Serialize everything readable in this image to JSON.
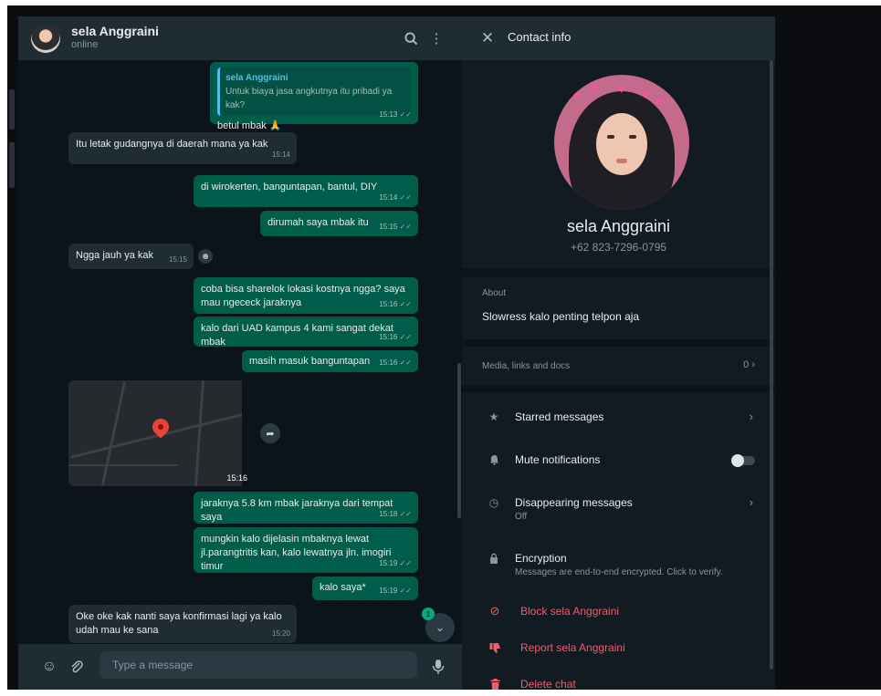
{
  "chat": {
    "contact_name": "sela Anggraini",
    "status": "online",
    "quoted": {
      "name": "sela Anggraini",
      "text": "Untuk biaya jasa angkutnya itu pribadi ya kak?"
    },
    "messages": [
      {
        "text": "betul mbak 🙏",
        "time": "15:13"
      },
      {
        "text": "Itu letak gudangnya di daerah mana ya kak",
        "time": "15:14"
      },
      {
        "text": "di wirokerten, banguntapan, bantul, DIY",
        "time": "15:14"
      },
      {
        "text": "dirumah saya mbak itu",
        "time": "15:15"
      },
      {
        "text": "Ngga jauh ya kak",
        "time": "15:15"
      },
      {
        "text": "coba bisa sharelok lokasi kostnya ngga? saya mau ngececk jaraknya",
        "time": "15:16"
      },
      {
        "text": "kalo dari UAD kampus 4 kami sangat dekat mbak",
        "time": "15:16"
      },
      {
        "text": "masih masuk banguntapan",
        "time": "15:16"
      },
      {
        "text": "jaraknya 5.8 km mbak jaraknya dari tempat saya",
        "time": "15:18"
      },
      {
        "text": "mungkin kalo dijelasin mbaknya lewat jl.parangtritis kan, kalo lewatnya jln. imogiri timur",
        "time": "15:19"
      },
      {
        "text": "kalo saya*",
        "time": "15:19"
      },
      {
        "text": "Oke oke kak nanti saya konfirmasi lagi ya kalo udah mau ke sana",
        "time": "15:20"
      }
    ],
    "map": {
      "time": "15:16"
    },
    "unread_count": "1",
    "composer_placeholder": "Type a message"
  },
  "panel": {
    "title": "Contact info",
    "name": "sela Anggraini",
    "phone": "+62 823-7296-0795",
    "about_label": "About",
    "about_value": "Slowress kalo penting telpon aja",
    "media_label": "Media, links and docs",
    "media_count": "0",
    "starred": "Starred messages",
    "mute": "Mute notifications",
    "mute_enabled": false,
    "disappearing": "Disappearing messages",
    "disappearing_value": "Off",
    "encryption": "Encryption",
    "encryption_sub": "Messages are end-to-end encrypted. Click to verify.",
    "block": "Block sela Anggraini",
    "report": "Report sela Anggraini",
    "delete": "Delete chat"
  },
  "colors": {
    "outgoing_bubble": "#005c4b",
    "incoming_bubble": "#202c33",
    "danger": "#f15c6d",
    "accent": "#00a884"
  },
  "icons": [
    "search-icon",
    "menu-icon",
    "close-icon",
    "emoji-icon",
    "attach-icon",
    "mic-icon",
    "star-icon",
    "bell-icon",
    "timer-icon",
    "lock-icon",
    "block-icon",
    "thumbs-down-icon",
    "trash-icon",
    "map-pin-icon",
    "forward-icon",
    "chevron-down-icon",
    "chevron-right-icon"
  ]
}
